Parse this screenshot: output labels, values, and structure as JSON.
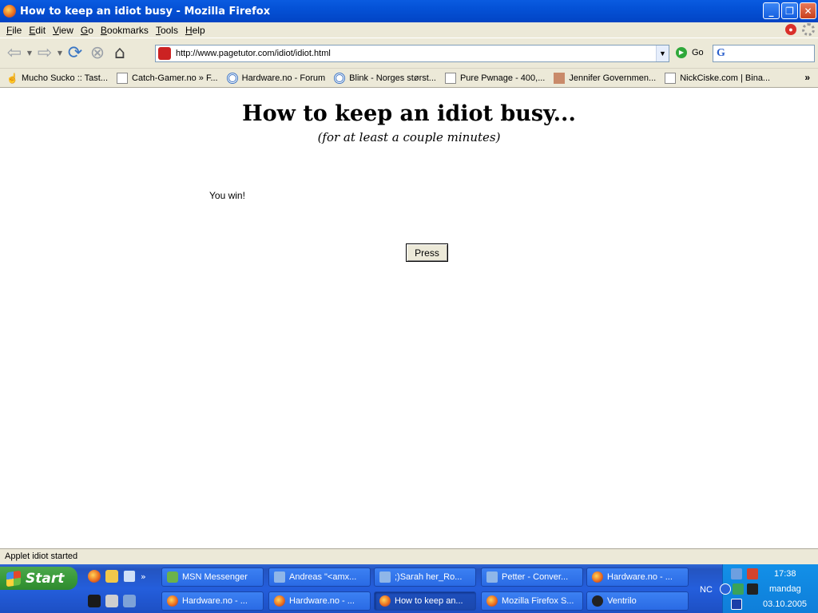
{
  "window": {
    "title": "How to keep an idiot busy - Mozilla Firefox"
  },
  "menu": {
    "items": [
      {
        "label": "File",
        "u": "F",
        "rest": "ile"
      },
      {
        "label": "Edit",
        "u": "E",
        "rest": "dit"
      },
      {
        "label": "View",
        "u": "V",
        "rest": "iew"
      },
      {
        "label": "Go",
        "u": "G",
        "rest": "o"
      },
      {
        "label": "Bookmarks",
        "u": "B",
        "rest": "ookmarks"
      },
      {
        "label": "Tools",
        "u": "T",
        "rest": "ools"
      },
      {
        "label": "Help",
        "u": "H",
        "rest": "elp"
      }
    ]
  },
  "toolbar": {
    "url": "http://www.pagetutor.com/idiot/idiot.html",
    "go_label": "Go"
  },
  "bookmarks": [
    {
      "label": "Mucho Sucko :: Tast...",
      "icon": "hand"
    },
    {
      "label": "Catch-Gamer.no » F...",
      "icon": "page"
    },
    {
      "label": "Hardware.no - Forum",
      "icon": "circle"
    },
    {
      "label": "Blink - Norges størst...",
      "icon": "circle"
    },
    {
      "label": "Pure Pwnage - 400,...",
      "icon": "page"
    },
    {
      "label": "Jennifer Governmen...",
      "icon": "face"
    },
    {
      "label": "NickCiske.com | Bina...",
      "icon": "page"
    }
  ],
  "page": {
    "heading": "How to keep an idiot busy...",
    "subheading": "(for at least a couple minutes)",
    "applet_text": "You win!",
    "button_label": "Press"
  },
  "status": {
    "text": "Applet idiot started"
  },
  "taskbar": {
    "start_label": "Start",
    "row1": [
      {
        "label": "MSN Messenger",
        "icon": "msn",
        "active": false
      },
      {
        "label": "Andreas \"<amx...",
        "icon": "chat",
        "active": false
      },
      {
        "label": ";)Sarah her_Ro...",
        "icon": "chat",
        "active": false
      },
      {
        "label": "Petter - Conver...",
        "icon": "chat",
        "active": false
      },
      {
        "label": "Hardware.no - ...",
        "icon": "ff",
        "active": false
      }
    ],
    "row2": [
      {
        "label": "Hardware.no - ...",
        "icon": "ff",
        "active": false
      },
      {
        "label": "Hardware.no - ...",
        "icon": "ff",
        "active": false
      },
      {
        "label": "How to keep an...",
        "icon": "ff",
        "active": true
      },
      {
        "label": "Mozilla Firefox S...",
        "icon": "ff",
        "active": false
      },
      {
        "label": "Ventrilo",
        "icon": "vent",
        "active": false
      }
    ],
    "tray": {
      "lang": "NC",
      "time": "17:38",
      "day": "mandag",
      "date": "03.10.2005"
    }
  }
}
